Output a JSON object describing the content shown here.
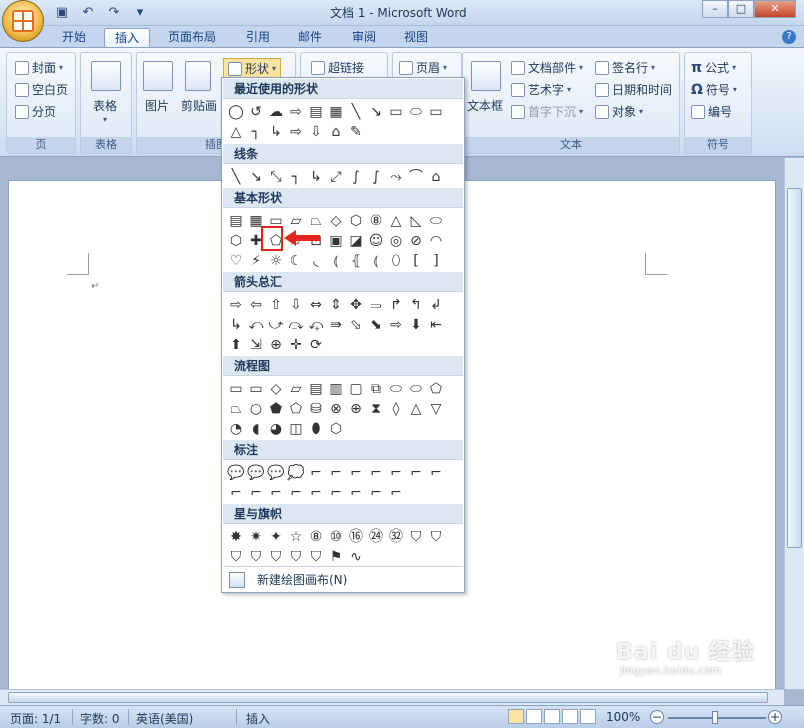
{
  "app": {
    "title": "文档 1 - Microsoft Word",
    "window_controls": [
      "–",
      "□",
      "✕"
    ],
    "help": "?"
  },
  "tabs": [
    "开始",
    "插入",
    "页面布局",
    "引用",
    "邮件",
    "审阅",
    "视图"
  ],
  "active_tab": "插入",
  "ribbon": {
    "pages_group": {
      "label": "页",
      "items": [
        "封面",
        "空白页",
        "分页"
      ]
    },
    "table_group": {
      "label": "表格",
      "button": "表格"
    },
    "illustrations_group": {
      "label": "插图",
      "picture": "图片",
      "clipart": "剪贴画",
      "shapes": "形状"
    },
    "links_group": {
      "hyperlink": "超链接"
    },
    "header_group": {
      "header": "页眉"
    },
    "text_group": {
      "label": "文本",
      "textbox": "文本框",
      "quickparts": "文档部件",
      "wordart": "艺术字",
      "dropcap": "首字下沉",
      "signature": "签名行",
      "datetime": "日期和时间",
      "object": "对象"
    },
    "symbols_group": {
      "label": "符号",
      "equation": "公式",
      "symbol": "符号",
      "number": "编号"
    }
  },
  "shapes_menu": {
    "sections": [
      {
        "title": "最近使用的形状",
        "shapes": [
          "◯",
          "↺",
          "☁",
          "⇨",
          "▤",
          "▦",
          "╲",
          "↘",
          "▭",
          "⬭",
          "▭",
          "△",
          "┐",
          "↳",
          "⇨",
          "⇩",
          "⌂",
          "✎"
        ]
      },
      {
        "title": "线条",
        "shapes": [
          "╲",
          "↘",
          "⤡",
          "┐",
          "↳",
          "⤢",
          "∫",
          "∫",
          "⤳",
          "⌒",
          "⌂",
          "✎"
        ]
      },
      {
        "title": "基本形状",
        "shapes": [
          "▤",
          "▦",
          "▭",
          "▱",
          "⏢",
          "◇",
          "⬡",
          "⑧",
          "△",
          "◺",
          "⬭",
          "⬡",
          "✚",
          "⬠",
          "⌭",
          "⊡",
          "▣",
          "◪",
          "☺",
          "◎",
          "⊘",
          "◠",
          "♡",
          "⚡",
          "☼",
          "☾",
          "◟",
          "⦅",
          "⦃",
          "⦅",
          "⬯",
          "[",
          "]",
          "{",
          "}"
        ]
      },
      {
        "title": "箭头总汇",
        "shapes": [
          "⇨",
          "⇦",
          "⇧",
          "⇩",
          "⇔",
          "⇕",
          "✥",
          "⥰",
          "↱",
          "↰",
          "↲",
          "↳",
          "⤺",
          "⤻",
          "⤼",
          "⤽",
          "⇛",
          "⬂",
          "⬊",
          "⇨",
          "⬇",
          "⇤",
          "⬆",
          "⇲",
          "⊕",
          "✛",
          "⟳"
        ]
      },
      {
        "title": "流程图",
        "shapes": [
          "▭",
          "▭",
          "◇",
          "▱",
          "▤",
          "▥",
          "▢",
          "⧉",
          "⬭",
          "⬭",
          "⬠",
          "⏢",
          "○",
          "⬟",
          "⬠",
          "⛁",
          "⊗",
          "⊕",
          "⧗",
          "◊",
          "△",
          "▽",
          "◔",
          "◖",
          "◕",
          "◫",
          "⬮",
          "⬡"
        ]
      },
      {
        "title": "标注",
        "shapes": [
          "💬",
          "💬",
          "💬",
          "💭",
          "⌐",
          "⌐",
          "⌐",
          "⌐",
          "⌐",
          "⌐",
          "⌐",
          "⌐",
          "⌐",
          "⌐",
          "⌐",
          "⌐",
          "⌐",
          "⌐",
          "⌐",
          "⌐"
        ]
      },
      {
        "title": "星与旗帜",
        "shapes": [
          "✸",
          "✷",
          "✦",
          "☆",
          "⑧",
          "⑩",
          "⑯",
          "㉔",
          "㉜",
          "⛉",
          "⛉",
          "⛉",
          "⛉",
          "⛉",
          "⛉",
          "⛉",
          "⚑",
          "∿"
        ]
      }
    ],
    "highlighted_shape": "⌭",
    "new_canvas": "新建绘图画布(N)"
  },
  "document": {
    "paragraph_mark": "↵"
  },
  "statusbar": {
    "page": "页面: 1/1",
    "words": "字数: 0",
    "language": "英语(美国)",
    "mode": "插入",
    "zoom": "100%",
    "zoom_minus": "−",
    "zoom_plus": "+"
  },
  "watermark": {
    "logo": "Bai du 经验",
    "url": "jingyan.baidu.com"
  },
  "colors": {
    "ribbon_bg": "#dae6f4",
    "accent_red": "#e4231c",
    "office_orange": "#e56e1c"
  }
}
